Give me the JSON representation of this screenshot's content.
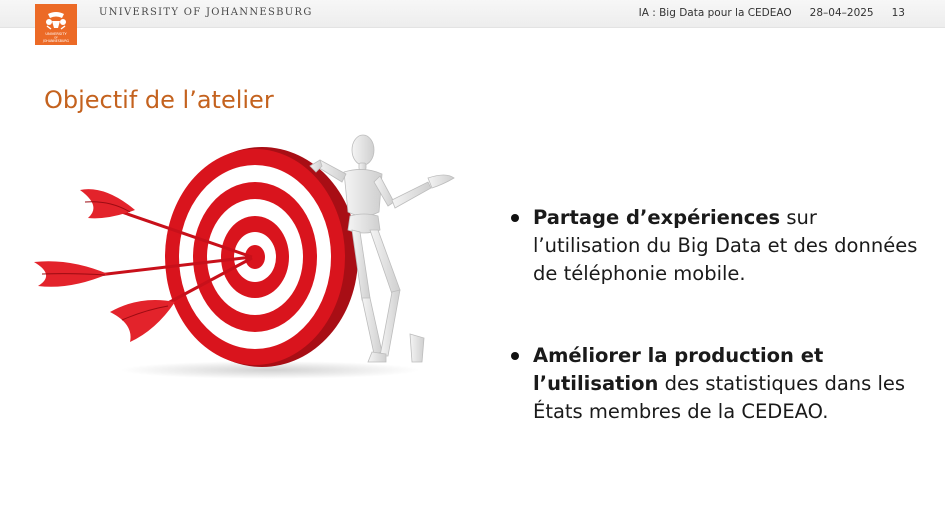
{
  "header": {
    "logo_text": [
      "UNIVERSITY",
      "OF",
      "JOHANNESBURG"
    ],
    "institution": "UNIVERSITY OF JOHANNESBURG",
    "short_title": "IA : Big Data pour la CEDEAO",
    "date": "28–04–2025",
    "page_number": "13"
  },
  "slide": {
    "title": "Objectif de l’atelier",
    "bullets": [
      {
        "bold": "Partage d’expériences",
        "rest": " sur l’utilisation du Big Data et des données de téléphonie mobile."
      },
      {
        "bold": "Améliorer la production et l’utilisation",
        "rest": " des statistiques dans les États membres de la CEDEAO."
      }
    ]
  },
  "colors": {
    "accent": "#c4621e",
    "logo_bg": "#ec6a26",
    "target_red": "#d9141d"
  }
}
